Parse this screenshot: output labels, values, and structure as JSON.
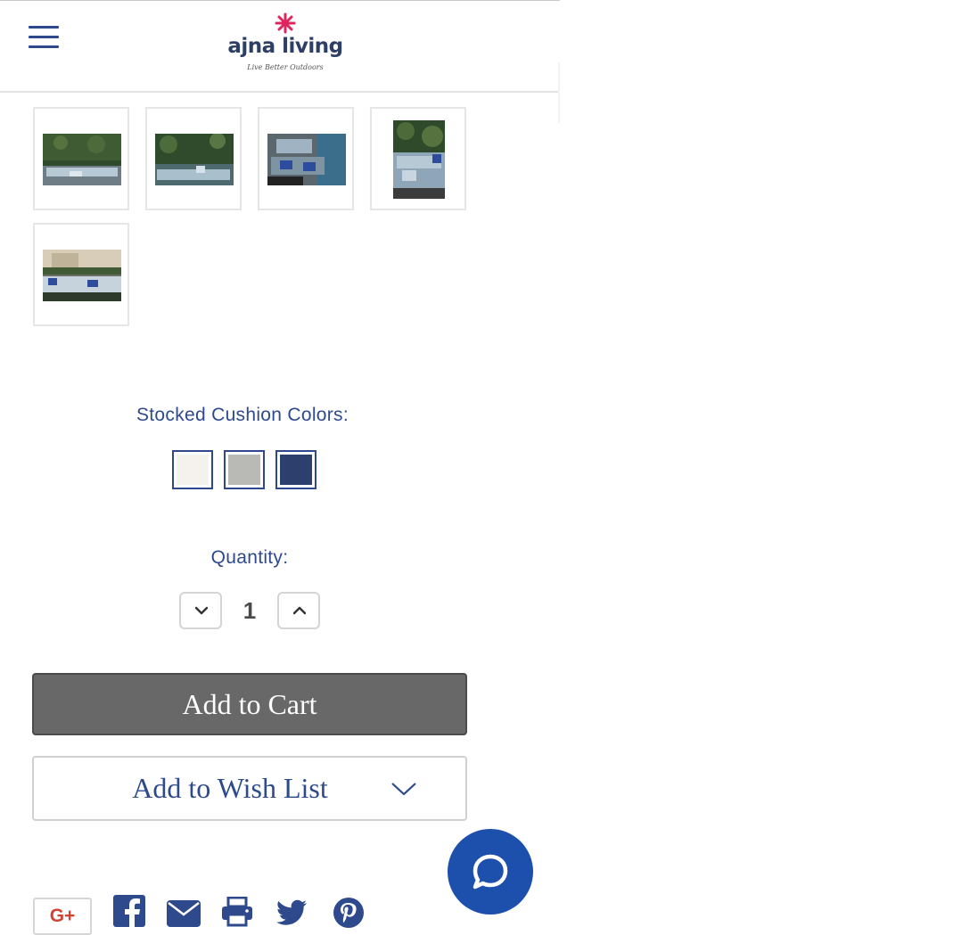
{
  "header": {
    "menu_icon": "hamburger-menu-icon",
    "logo": {
      "wordmark": "ajna living",
      "tagline": "Live Better Outdoors",
      "flower_color": "#e0245e"
    }
  },
  "gallery": {
    "thumbnails": [
      {
        "alt": "Outdoor sectional with hedge backdrop"
      },
      {
        "alt": "Outdoor sectional set on patio"
      },
      {
        "alt": "Sectional arrangement by pool"
      },
      {
        "alt": "Sectional corner view"
      },
      {
        "alt": "Sectional lounge near fence"
      }
    ]
  },
  "cushions": {
    "label": "Stocked Cushion Colors:",
    "swatches": [
      {
        "name": "white",
        "color": "#f4f2ec"
      },
      {
        "name": "gray",
        "color": "#b9b9b6"
      },
      {
        "name": "navy",
        "color": "#2c3f6d"
      }
    ]
  },
  "quantity": {
    "label": "Quantity:",
    "value": "1",
    "decrease_icon": "chevron-down-icon",
    "increase_icon": "chevron-up-icon"
  },
  "actions": {
    "add_to_cart": "Add to Cart",
    "add_to_wishlist": "Add to Wish List",
    "wishlist_icon": "chevron-down-icon"
  },
  "chat": {
    "icon": "chat-bubble-icon",
    "color": "#1d4fad"
  },
  "share": {
    "google_plus": "G+",
    "icons": [
      "facebook-icon",
      "email-icon",
      "print-icon",
      "twitter-icon",
      "pinterest-icon"
    ],
    "color": "#2e4a8c"
  }
}
